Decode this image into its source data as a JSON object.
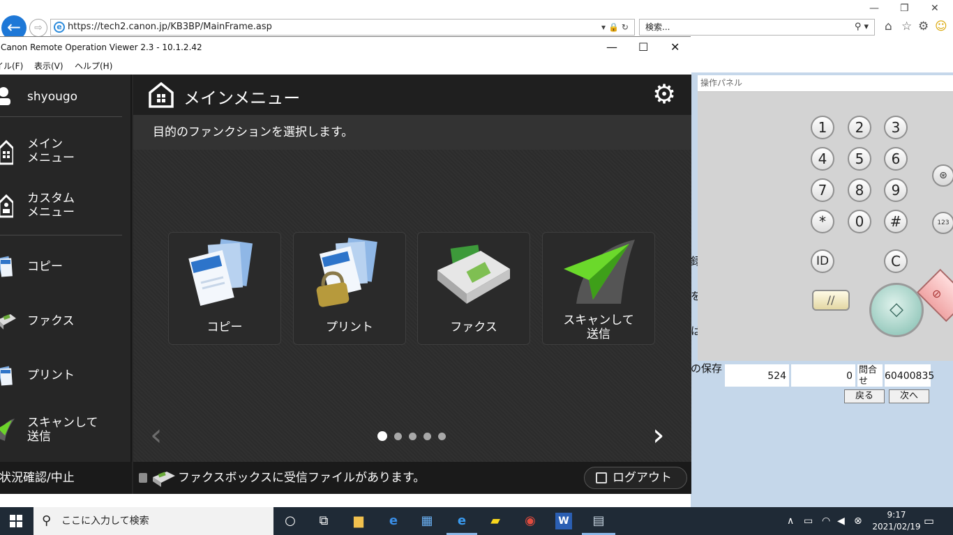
{
  "browser": {
    "url": "https://tech2.canon.jp/KB3BP/MainFrame.asp",
    "search_placeholder": "検索...",
    "colors": {
      "back_button": "#1e78d7"
    }
  },
  "viewer": {
    "title": "Canon Remote Operation Viewer 2.3 - 10.1.2.42",
    "menus": [
      "ファイル(F)",
      "表示(V)",
      "ヘルプ(H)"
    ],
    "user": "shyougo",
    "header_title": "メインメニュー",
    "subtitle": "目的のファンクションを選択します。",
    "sidebar": [
      {
        "label1": "メイン",
        "label2": "メニュー",
        "icon": "home-icon"
      },
      {
        "label1": "カスタム",
        "label2": "メニュー",
        "icon": "custom-menu-icon"
      },
      {
        "label1": "コピー",
        "label2": "",
        "icon": "copy-icon"
      },
      {
        "label1": "ファクス",
        "label2": "",
        "icon": "fax-icon"
      },
      {
        "label1": "プリント",
        "label2": "",
        "icon": "print-icon"
      },
      {
        "label1": "スキャンして",
        "label2": "送信",
        "icon": "scan-send-icon"
      }
    ],
    "sidebar_bottom": "状況確認/中止",
    "tiles": [
      {
        "label1": "コピー",
        "label2": "",
        "icon": "copy-icon"
      },
      {
        "label1": "プリント",
        "label2": "",
        "icon": "print-icon"
      },
      {
        "label1": "ファクス",
        "label2": "",
        "icon": "fax-icon"
      },
      {
        "label1": "スキャンして",
        "label2": "送信",
        "icon": "scan-send-icon"
      }
    ],
    "pager": {
      "current_page": 1,
      "total_pages": 5
    },
    "footer_message": "ファクスボックスに受信ファイルがあります。",
    "logout_label": "ログアウト"
  },
  "operation_panel": {
    "title": "操作パネル",
    "keys": [
      "1",
      "2",
      "3",
      "4",
      "5",
      "6",
      "7",
      "8",
      "9",
      "*",
      "0",
      "#"
    ],
    "id_key": "ID",
    "clear_key": "C",
    "reset_key": "//",
    "start_key": "◇",
    "side_keys": [
      "settings-counter-icon",
      "numeric-keypad-icon"
    ]
  },
  "background_page": {
    "row_labels": [
      "録",
      "を",
      "は",
      "の保存"
    ],
    "table_row": [
      "524",
      "0",
      "問合せ",
      "60400835"
    ],
    "buttons": [
      "戻る",
      "次へ"
    ]
  },
  "taskbar": {
    "search_placeholder": "ここに入力して検索",
    "time": "9:17",
    "date": "2021/02/19"
  }
}
